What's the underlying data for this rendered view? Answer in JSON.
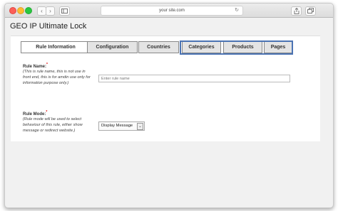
{
  "browser": {
    "address": "your site.com",
    "back_glyph": "‹",
    "forward_glyph": "›",
    "reload_glyph": "↻"
  },
  "page": {
    "title": "GEO IP Ultimate Lock"
  },
  "tabs": [
    {
      "label": "Rule Information",
      "active": true
    },
    {
      "label": "Configuration",
      "active": false
    },
    {
      "label": "Countries",
      "active": false
    },
    {
      "label": "Categories",
      "active": false
    },
    {
      "label": "Products",
      "active": false
    },
    {
      "label": "Pages",
      "active": false
    }
  ],
  "form": {
    "rule_name": {
      "label": "Rule Name:",
      "required_mark": "*",
      "help": "(This is rule name, this is not use in front end, this is for amdin use only for information purpose only.)",
      "placeholder": "Enter rule name",
      "value": ""
    },
    "rule_mode": {
      "label": "Rule Mode:",
      "required_mark": "*",
      "help": "(Rule mode will be used to select behaviour of this rule, either show message or redirect website.)",
      "selected": "Display Message"
    }
  },
  "colors": {
    "highlight": "#4b73b3",
    "required": "#dd0000"
  },
  "icons": [
    "back-icon",
    "forward-icon",
    "sidebar-icon",
    "reload-icon",
    "share-icon",
    "tabs-icon"
  ]
}
